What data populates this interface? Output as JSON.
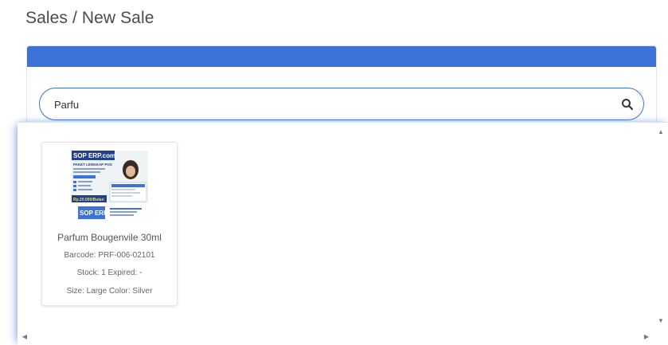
{
  "breadcrumb": "Sales / New Sale",
  "colors": {
    "accent": "#3d72d7"
  },
  "search": {
    "value": "Parfu",
    "icon": "search-icon"
  },
  "results": [
    {
      "image_alt": "SOP ERP POS package ad",
      "image_texts": {
        "brand": "SOP ERP.com",
        "headline": "PAKET LENGKAP POS",
        "price": "Rp.20.000/Bulan",
        "logo": "SOP ERP"
      },
      "name": "Parfum Bougenvile 30ml",
      "barcode": "Barcode: PRF-006-02101",
      "stock": "Stock: 1 Expired: -",
      "attributes": "Size: Large Color: Silver"
    }
  ]
}
